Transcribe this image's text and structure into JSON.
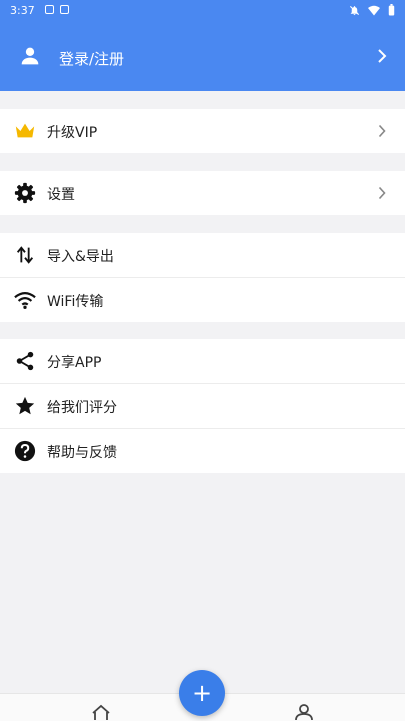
{
  "status_bar": {
    "time": "3:37"
  },
  "header": {
    "login_label": "登录/注册"
  },
  "menu": {
    "vip": "升级VIP",
    "settings": "设置",
    "import_export": "导入&导出",
    "wifi": "WiFi传输",
    "share": "分享APP",
    "rate": "给我们评分",
    "help": "帮助与反馈"
  },
  "fab": {
    "label": "+"
  },
  "colors": {
    "primary": "#4a88f1",
    "fab": "#3a7ee9",
    "background": "#f2f2f4",
    "crown": "#f5b800"
  },
  "icons": {
    "header": "user-icon",
    "vip": "crown-icon",
    "settings": "gear-icon",
    "import_export": "swap-vertical-icon",
    "wifi": "wifi-icon",
    "share": "share-icon",
    "rate": "star-icon",
    "help": "help-circle-icon",
    "nav_home": "home-icon",
    "nav_me": "person-icon"
  }
}
